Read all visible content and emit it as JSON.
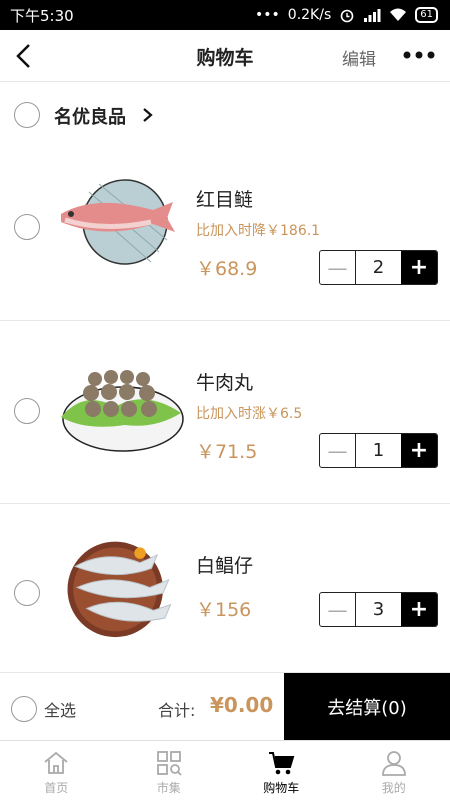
{
  "status_bar": {
    "time": "下午5:30",
    "network_speed": "0.2K/s",
    "battery": "61",
    "dots": "•••"
  },
  "nav": {
    "title": "购物车",
    "edit_label": "编辑",
    "back_icon": "chevron-left-icon",
    "more_icon": "more-dots-icon"
  },
  "store": {
    "name": "名优良品"
  },
  "items": [
    {
      "name": "红目鲢",
      "note": "比加入时降￥186.1",
      "price": "￥68.9",
      "qty": "2",
      "image": "fish-icon"
    },
    {
      "name": "牛肉丸",
      "note": "比加入时涨￥6.5",
      "price": "￥71.5",
      "qty": "1",
      "image": "meatballs-icon"
    },
    {
      "name": "白鲳仔",
      "note": "",
      "price": "￥156",
      "qty": "3",
      "image": "pomfret-icon"
    }
  ],
  "stepper": {
    "minus": "—",
    "plus": "+"
  },
  "checkout": {
    "select_all": "全选",
    "total_label": "合计:",
    "total_value": "¥0.00",
    "pay_button": "去结算(0)"
  },
  "tabs": [
    {
      "label": "首页",
      "icon": "home-icon",
      "active": false
    },
    {
      "label": "市集",
      "icon": "market-icon",
      "active": false
    },
    {
      "label": "购物车",
      "icon": "cart-icon",
      "active": true
    },
    {
      "label": "我的",
      "icon": "user-icon",
      "active": false
    }
  ],
  "colors": {
    "accent": "#c9955c",
    "primary": "#000000"
  }
}
